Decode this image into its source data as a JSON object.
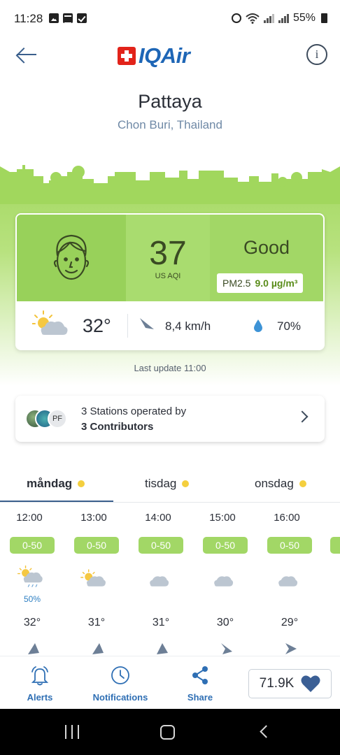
{
  "status_bar": {
    "time": "11:28",
    "battery": "55%",
    "icons_left": [
      "image-icon",
      "news-icon",
      "check-icon"
    ],
    "icons_right": [
      "alarm-icon",
      "wifi-icon",
      "signal-icon",
      "signal-icon",
      "battery-icon"
    ]
  },
  "header": {
    "logo_text": "IQAir",
    "logo_color": "#1e66b6",
    "cross_color": "#e2231a",
    "info_label": "i"
  },
  "location": {
    "city": "Pattaya",
    "region": "Chon Buri, Thailand"
  },
  "aqi": {
    "value": "37",
    "unit": "US AQI",
    "status": "Good",
    "pollutant": "PM2.5",
    "pollutant_value": "9.0 µg/m³",
    "color": "#a2d766"
  },
  "weather": {
    "temperature": "32°",
    "wind": "8,4 km/h",
    "humidity": "70%"
  },
  "last_update": "Last update 11:00",
  "stations": {
    "line1": "3 Stations operated by",
    "line2": "3 Contributors",
    "avatar_initials": "PF"
  },
  "days": [
    {
      "label": "måndag",
      "active": true
    },
    {
      "label": "tisdag",
      "active": false
    },
    {
      "label": "onsdag",
      "active": false
    }
  ],
  "hourly": [
    {
      "time": "12:00",
      "aqi": "0-50",
      "icon": "partly-cloudy-rain-icon",
      "rain": "50%",
      "temp": "32°"
    },
    {
      "time": "13:00",
      "aqi": "0-50",
      "icon": "partly-cloudy-icon",
      "rain": "",
      "temp": "31°"
    },
    {
      "time": "14:00",
      "aqi": "0-50",
      "icon": "cloud-icon",
      "rain": "",
      "temp": "31°"
    },
    {
      "time": "15:00",
      "aqi": "0-50",
      "icon": "cloud-icon",
      "rain": "",
      "temp": "30°"
    },
    {
      "time": "16:00",
      "aqi": "0-50",
      "icon": "cloud-icon",
      "rain": "",
      "temp": "29°"
    }
  ],
  "bottom_bar": {
    "alerts": "Alerts",
    "notifications": "Notifications",
    "share": "Share",
    "likes": "71.9K"
  }
}
